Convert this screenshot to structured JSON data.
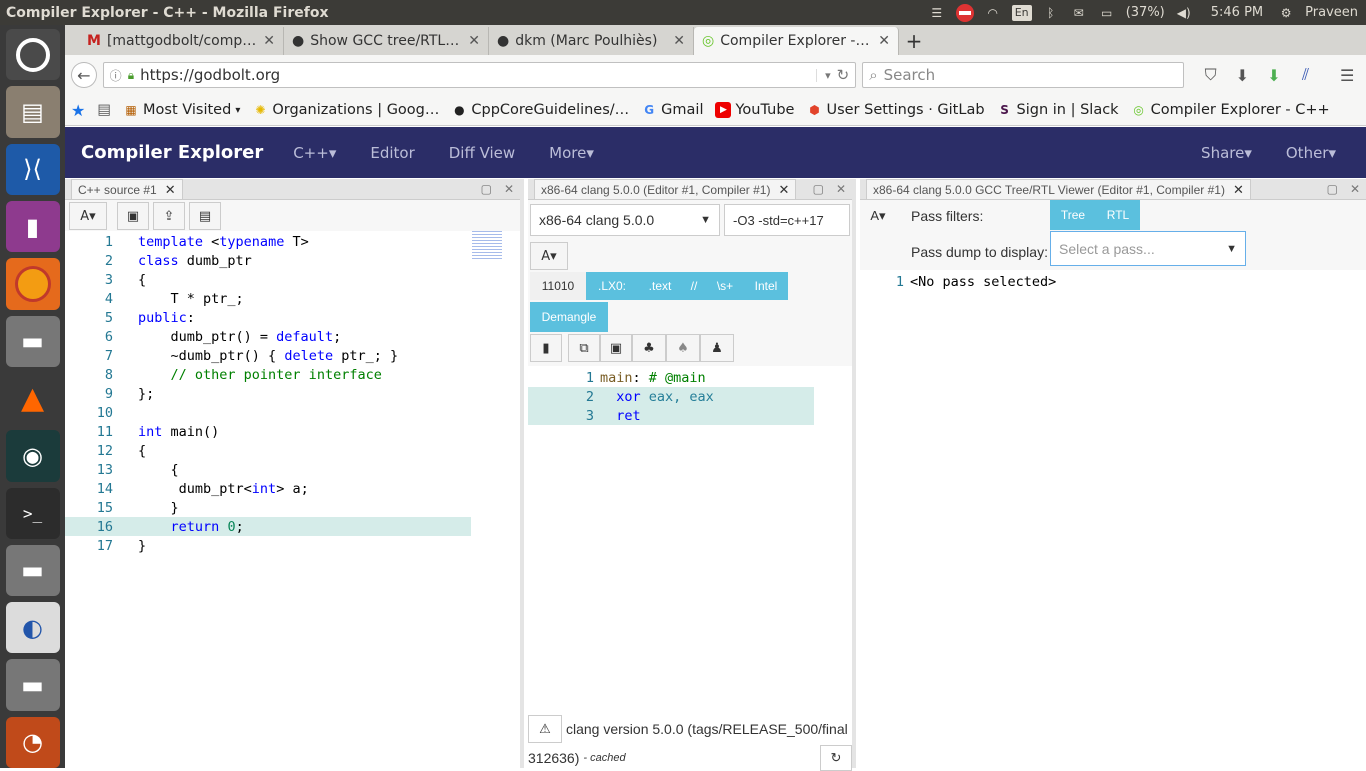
{
  "os": {
    "window_title": "Compiler Explorer - C++ - Mozilla Firefox",
    "keyboard": "En",
    "battery": "(37%)",
    "time": "5:46 PM",
    "user": "Praveen"
  },
  "browser": {
    "tabs": [
      {
        "label": "[mattgodbolt/comp…",
        "icon": "gmail-icon"
      },
      {
        "label": "Show GCC tree/RTL …",
        "icon": "github-icon"
      },
      {
        "label": "dkm (Marc Poulhiès)",
        "icon": "github-icon"
      },
      {
        "label": "Compiler Explorer - …",
        "icon": "compiler-explorer-icon"
      }
    ],
    "url": "https://godbolt.org",
    "search_placeholder": "Search",
    "bookmarks": [
      {
        "label": "Most Visited",
        "icon": "most-visited-icon"
      },
      {
        "label": "Organizations | Goog…",
        "icon": "organizations-icon"
      },
      {
        "label": "CppCoreGuidelines/…",
        "icon": "github-icon"
      },
      {
        "label": "Gmail",
        "icon": "google-icon"
      },
      {
        "label": "YouTube",
        "icon": "youtube-icon"
      },
      {
        "label": "User Settings · GitLab",
        "icon": "gitlab-icon"
      },
      {
        "label": "Sign in | Slack",
        "icon": "slack-icon"
      },
      {
        "label": "Compiler Explorer - C++",
        "icon": "compiler-explorer-icon"
      }
    ]
  },
  "ce": {
    "brand": "Compiler Explorer",
    "nav": [
      "C++▾",
      "Editor",
      "Diff View",
      "More▾"
    ],
    "nav_right": [
      "Share▾",
      "Other▾"
    ],
    "source": {
      "tab": "C++ source #1",
      "font_btn": "A▾",
      "lines": [
        [
          {
            "t": "template",
            "c": "kw"
          },
          {
            "t": " <"
          },
          {
            "t": "typename",
            "c": "kw"
          },
          {
            "t": " T>"
          }
        ],
        [
          {
            "t": "class",
            "c": "kw"
          },
          {
            "t": " dumb_ptr"
          }
        ],
        [
          {
            "t": "{"
          }
        ],
        [
          {
            "t": "    T * ptr_;"
          }
        ],
        [
          {
            "t": "public",
            "c": "kw"
          },
          {
            "t": ":"
          }
        ],
        [
          {
            "t": "    dumb_ptr() = "
          },
          {
            "t": "default",
            "c": "kw"
          },
          {
            "t": ";"
          }
        ],
        [
          {
            "t": "    ~dumb_ptr() { "
          },
          {
            "t": "delete",
            "c": "kw"
          },
          {
            "t": " ptr_; }"
          }
        ],
        [
          {
            "t": "    "
          },
          {
            "t": "// other pointer interface",
            "c": "cm"
          }
        ],
        [
          {
            "t": "};"
          }
        ],
        [
          {
            "t": ""
          }
        ],
        [
          {
            "t": "int",
            "c": "kw"
          },
          {
            "t": " main()"
          }
        ],
        [
          {
            "t": "{"
          }
        ],
        [
          {
            "t": "    {"
          }
        ],
        [
          {
            "t": "     dumb_ptr<"
          },
          {
            "t": "int",
            "c": "kw"
          },
          {
            "t": "> a;"
          }
        ],
        [
          {
            "t": "    }"
          }
        ],
        [
          {
            "t": "    "
          },
          {
            "t": "return",
            "c": "kw"
          },
          {
            "t": " "
          },
          {
            "t": "0",
            "c": "num"
          },
          {
            "t": ";"
          }
        ],
        [
          {
            "t": "}"
          }
        ]
      ]
    },
    "compiler": {
      "tab": "x86-64 clang 5.0.0 (Editor #1, Compiler #1)",
      "name": "x86-64 clang 5.0.0",
      "options": "-O3 -std=c++17",
      "font_btn": "A▾",
      "filters": [
        "11010",
        ".LX0:",
        ".text",
        "//",
        "\\s+",
        "Intel"
      ],
      "demangle": "Demangle",
      "asm_lines": [
        [
          {
            "t": "main",
            "c": "asmlabel"
          },
          {
            "t": ": "
          },
          {
            "t": "# @main",
            "c": "asmcm"
          }
        ],
        [
          {
            "t": "  xor",
            "c": "kw"
          },
          {
            "t": " eax, eax",
            "c": "asmreg"
          }
        ],
        [
          {
            "t": "  ret",
            "c": "kw"
          }
        ]
      ],
      "status": "clang version 5.0.0 (tags/RELEASE_500/final",
      "status2": "312636)",
      "cached": "- cached"
    },
    "viewer": {
      "tab": "x86-64 clang 5.0.0 GCC Tree/RTL Viewer (Editor #1, Compiler #1)",
      "font_btn": "A▾",
      "pass_filters_label": "Pass filters:",
      "pass_filters": [
        "Tree",
        "RTL"
      ],
      "pass_dump_label": "Pass dump to display:",
      "select_placeholder": "Select a pass...",
      "lines": [
        "<No pass selected>"
      ]
    }
  }
}
